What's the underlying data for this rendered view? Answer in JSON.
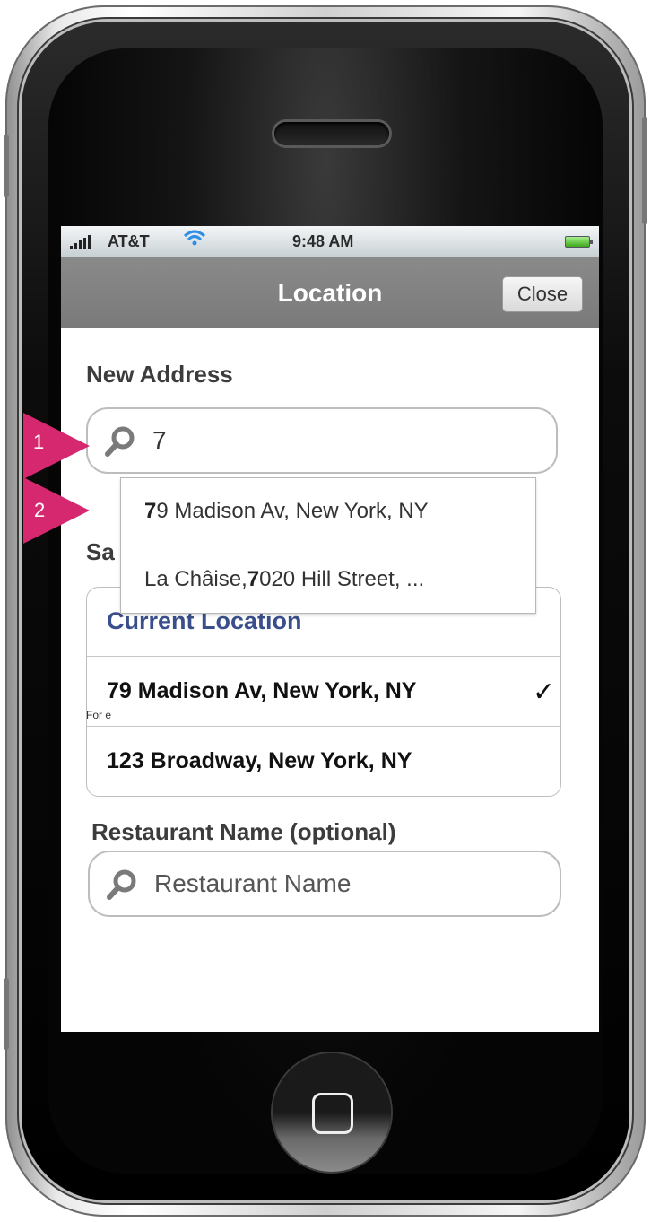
{
  "status_bar": {
    "carrier": "AT&T",
    "time": "9:48 AM"
  },
  "nav": {
    "title": "Location",
    "close_label": "Close"
  },
  "new_address": {
    "label": "New Address",
    "value": "7",
    "helper_text": "For e",
    "suggestions": [
      {
        "bold": "7",
        "rest": "9 Madison Av, New York, NY"
      },
      {
        "pre": "La Châise, ",
        "bold": "7",
        "rest": "020 Hill Street, ..."
      }
    ]
  },
  "saved": {
    "label_visible": "Sa",
    "items": [
      {
        "label": "Current Location",
        "selected": false
      },
      {
        "label": "79 Madison Av, New York, NY",
        "selected": true
      },
      {
        "label": "123 Broadway, New York, NY",
        "selected": false
      }
    ],
    "check_glyph": "✓"
  },
  "restaurant": {
    "label": "Restaurant Name (optional)",
    "placeholder": "Restaurant Name"
  },
  "markers": [
    "1",
    "2"
  ],
  "colors": {
    "nav_bg": "#808080",
    "marker": "#d6286e",
    "current_location": "#3a4e8c"
  }
}
